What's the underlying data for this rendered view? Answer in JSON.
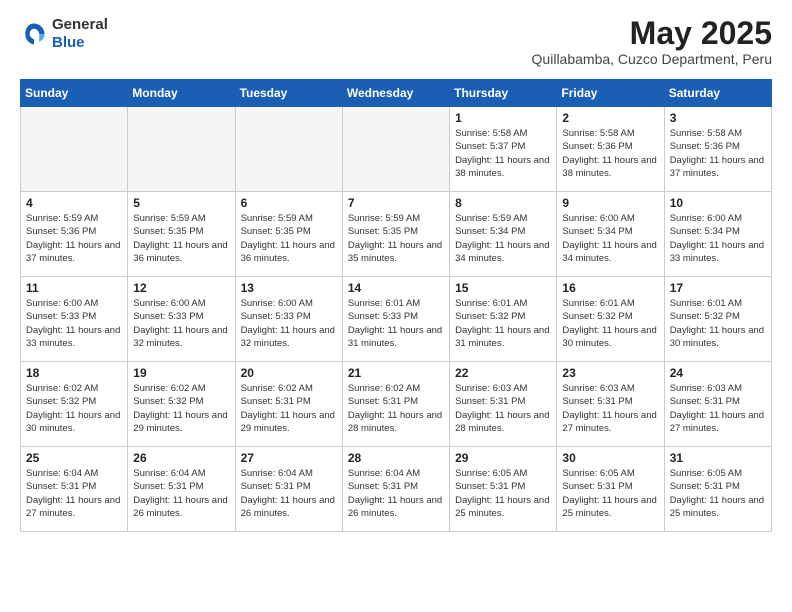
{
  "logo": {
    "general": "General",
    "blue": "Blue"
  },
  "title": "May 2025",
  "subtitle": "Quillabamba, Cuzco Department, Peru",
  "headers": [
    "Sunday",
    "Monday",
    "Tuesday",
    "Wednesday",
    "Thursday",
    "Friday",
    "Saturday"
  ],
  "weeks": [
    [
      {
        "day": "",
        "empty": true
      },
      {
        "day": "",
        "empty": true
      },
      {
        "day": "",
        "empty": true
      },
      {
        "day": "",
        "empty": true
      },
      {
        "day": "1",
        "detail": "Sunrise: 5:58 AM\nSunset: 5:37 PM\nDaylight: 11 hours\nand 38 minutes."
      },
      {
        "day": "2",
        "detail": "Sunrise: 5:58 AM\nSunset: 5:36 PM\nDaylight: 11 hours\nand 38 minutes."
      },
      {
        "day": "3",
        "detail": "Sunrise: 5:58 AM\nSunset: 5:36 PM\nDaylight: 11 hours\nand 37 minutes."
      }
    ],
    [
      {
        "day": "4",
        "detail": "Sunrise: 5:59 AM\nSunset: 5:36 PM\nDaylight: 11 hours\nand 37 minutes."
      },
      {
        "day": "5",
        "detail": "Sunrise: 5:59 AM\nSunset: 5:35 PM\nDaylight: 11 hours\nand 36 minutes."
      },
      {
        "day": "6",
        "detail": "Sunrise: 5:59 AM\nSunset: 5:35 PM\nDaylight: 11 hours\nand 36 minutes."
      },
      {
        "day": "7",
        "detail": "Sunrise: 5:59 AM\nSunset: 5:35 PM\nDaylight: 11 hours\nand 35 minutes."
      },
      {
        "day": "8",
        "detail": "Sunrise: 5:59 AM\nSunset: 5:34 PM\nDaylight: 11 hours\nand 34 minutes."
      },
      {
        "day": "9",
        "detail": "Sunrise: 6:00 AM\nSunset: 5:34 PM\nDaylight: 11 hours\nand 34 minutes."
      },
      {
        "day": "10",
        "detail": "Sunrise: 6:00 AM\nSunset: 5:34 PM\nDaylight: 11 hours\nand 33 minutes."
      }
    ],
    [
      {
        "day": "11",
        "detail": "Sunrise: 6:00 AM\nSunset: 5:33 PM\nDaylight: 11 hours\nand 33 minutes."
      },
      {
        "day": "12",
        "detail": "Sunrise: 6:00 AM\nSunset: 5:33 PM\nDaylight: 11 hours\nand 32 minutes."
      },
      {
        "day": "13",
        "detail": "Sunrise: 6:00 AM\nSunset: 5:33 PM\nDaylight: 11 hours\nand 32 minutes."
      },
      {
        "day": "14",
        "detail": "Sunrise: 6:01 AM\nSunset: 5:33 PM\nDaylight: 11 hours\nand 31 minutes."
      },
      {
        "day": "15",
        "detail": "Sunrise: 6:01 AM\nSunset: 5:32 PM\nDaylight: 11 hours\nand 31 minutes."
      },
      {
        "day": "16",
        "detail": "Sunrise: 6:01 AM\nSunset: 5:32 PM\nDaylight: 11 hours\nand 30 minutes."
      },
      {
        "day": "17",
        "detail": "Sunrise: 6:01 AM\nSunset: 5:32 PM\nDaylight: 11 hours\nand 30 minutes."
      }
    ],
    [
      {
        "day": "18",
        "detail": "Sunrise: 6:02 AM\nSunset: 5:32 PM\nDaylight: 11 hours\nand 30 minutes."
      },
      {
        "day": "19",
        "detail": "Sunrise: 6:02 AM\nSunset: 5:32 PM\nDaylight: 11 hours\nand 29 minutes."
      },
      {
        "day": "20",
        "detail": "Sunrise: 6:02 AM\nSunset: 5:31 PM\nDaylight: 11 hours\nand 29 minutes."
      },
      {
        "day": "21",
        "detail": "Sunrise: 6:02 AM\nSunset: 5:31 PM\nDaylight: 11 hours\nand 28 minutes."
      },
      {
        "day": "22",
        "detail": "Sunrise: 6:03 AM\nSunset: 5:31 PM\nDaylight: 11 hours\nand 28 minutes."
      },
      {
        "day": "23",
        "detail": "Sunrise: 6:03 AM\nSunset: 5:31 PM\nDaylight: 11 hours\nand 27 minutes."
      },
      {
        "day": "24",
        "detail": "Sunrise: 6:03 AM\nSunset: 5:31 PM\nDaylight: 11 hours\nand 27 minutes."
      }
    ],
    [
      {
        "day": "25",
        "detail": "Sunrise: 6:04 AM\nSunset: 5:31 PM\nDaylight: 11 hours\nand 27 minutes."
      },
      {
        "day": "26",
        "detail": "Sunrise: 6:04 AM\nSunset: 5:31 PM\nDaylight: 11 hours\nand 26 minutes."
      },
      {
        "day": "27",
        "detail": "Sunrise: 6:04 AM\nSunset: 5:31 PM\nDaylight: 11 hours\nand 26 minutes."
      },
      {
        "day": "28",
        "detail": "Sunrise: 6:04 AM\nSunset: 5:31 PM\nDaylight: 11 hours\nand 26 minutes."
      },
      {
        "day": "29",
        "detail": "Sunrise: 6:05 AM\nSunset: 5:31 PM\nDaylight: 11 hours\nand 25 minutes."
      },
      {
        "day": "30",
        "detail": "Sunrise: 6:05 AM\nSunset: 5:31 PM\nDaylight: 11 hours\nand 25 minutes."
      },
      {
        "day": "31",
        "detail": "Sunrise: 6:05 AM\nSunset: 5:31 PM\nDaylight: 11 hours\nand 25 minutes."
      }
    ]
  ]
}
